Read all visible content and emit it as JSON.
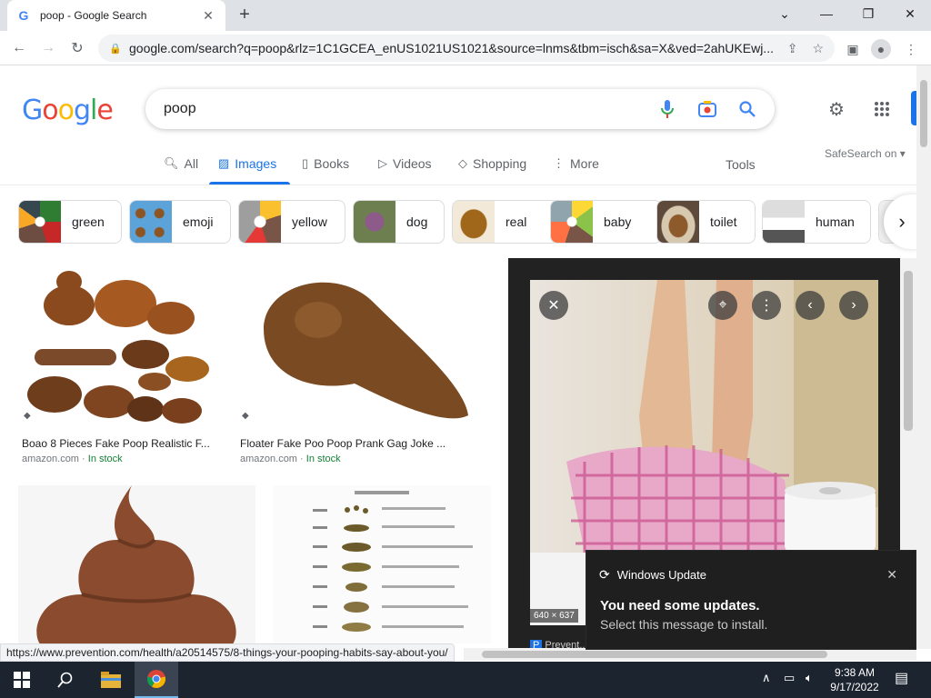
{
  "browser": {
    "tab_title": "poop - Google Search",
    "url": "google.com/search?q=poop&rlz=1C1GCEA_enUS1021US1021&source=lnms&tbm=isch&sa=X&ved=2ahUKEwj...",
    "status_url": "https://www.prevention.com/health/a20514575/8-things-your-pooping-habits-say-about-you/"
  },
  "search": {
    "query": "poop",
    "tabs": [
      {
        "label": "All",
        "icon": "search-icon"
      },
      {
        "label": "Images",
        "icon": "image-icon"
      },
      {
        "label": "Books",
        "icon": "book-icon"
      },
      {
        "label": "Videos",
        "icon": "video-icon"
      },
      {
        "label": "Shopping",
        "icon": "tag-icon"
      },
      {
        "label": "More",
        "icon": "more-vert-icon"
      }
    ],
    "active_tab": "Images",
    "tools_label": "Tools",
    "safesearch_label": "SafeSearch on"
  },
  "chips": [
    {
      "label": "green"
    },
    {
      "label": "emoji"
    },
    {
      "label": "yellow"
    },
    {
      "label": "dog"
    },
    {
      "label": "real"
    },
    {
      "label": "baby"
    },
    {
      "label": "toilet"
    },
    {
      "label": "human"
    }
  ],
  "results": [
    {
      "caption": "Boao 8 Pieces Fake Poop Realistic F...",
      "source": "amazon.com",
      "stock": "In stock"
    },
    {
      "caption": "Floater Fake Poo Poop Prank Gag Joke ...",
      "source": "amazon.com",
      "stock": "In stock"
    }
  ],
  "preview": {
    "dimensions": "640 × 637",
    "source_initial": "P",
    "source_partial": "Prevent..."
  },
  "toast": {
    "app": "Windows Update",
    "title": "You need some updates.",
    "subtitle": "Select this message to install."
  },
  "taskbar": {
    "time": "9:38 AM",
    "date": "9/17/2022"
  },
  "colors": {
    "accent": "#1a73e8",
    "preview_bg": "#222222",
    "toast_bg": "#1f1f1f",
    "taskbar_bg": "#1c2430"
  }
}
